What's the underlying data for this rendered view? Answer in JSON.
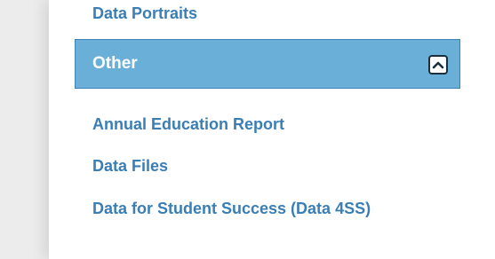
{
  "nav": {
    "previous_link": "Data Portraits",
    "section": {
      "title": "Other",
      "toggle_icon": "chevron-up-icon"
    },
    "links": [
      "Annual Education Report",
      "Data Files",
      "Data for Student Success (Data 4SS)"
    ]
  },
  "colors": {
    "link": "#3a7eb6",
    "header_bg": "#6aafd8",
    "header_border": "#3f82b4"
  }
}
